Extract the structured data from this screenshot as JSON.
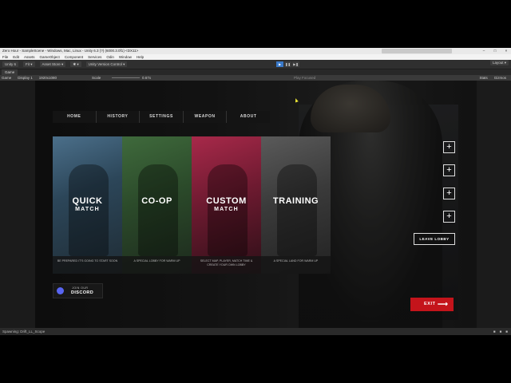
{
  "window": {
    "title": "Zero Hour - SampleScene - Windows, Mac, Linux - Unity 6.3 (?) (6000.3.0f1) <DX11>",
    "controls": [
      "–",
      "□",
      "×"
    ]
  },
  "menu": [
    "File",
    "Edit",
    "Assets",
    "GameObject",
    "Component",
    "Services",
    "Odin",
    "Window",
    "Help"
  ],
  "toolbar": {
    "unity_label": "Unity 6",
    "left_items": [
      "Fit ▾",
      "Asset Store ▾",
      "✱ ▾",
      "Unity Version Control ▾"
    ],
    "play_buttons": [
      "▶",
      "❚❚",
      "▶❚"
    ],
    "right_items": [
      "Layout ▾"
    ]
  },
  "tab": {
    "label": "Game"
  },
  "gamebar": {
    "items": [
      "Game",
      "Display 1",
      "1920x1080"
    ],
    "scale_label": "Scale",
    "scale_value": "0.67x",
    "play_focus": "Play Focused",
    "right_items": [
      "Stats",
      "Gizmos"
    ]
  },
  "nav": [
    "HOME",
    "HISTORY",
    "SETTINGS",
    "WEAPON",
    "ABOUT"
  ],
  "modes": [
    {
      "line1": "QUICK",
      "line2": "MATCH",
      "desc": "BE PREPARED IT'S GOING TO START SOON"
    },
    {
      "line1": "CO-OP",
      "line2": "",
      "desc": "A SPECIAL LOBBY FOR WARM UP"
    },
    {
      "line1": "CUSTOM",
      "line2": "MATCH",
      "desc": "SELECT MAP, PLAYER, MATCH TIME & CREATE YOUR OWN LOBBY"
    },
    {
      "line1": "TRAINING",
      "line2": "",
      "desc": "A SPECIAL LAND FOR WARM UP"
    }
  ],
  "party": {
    "slot_symbol": "+",
    "leave_label": "LEAVE LOBBY"
  },
  "discord": {
    "line1": "JOIN OUR",
    "line2": "DISCORD"
  },
  "exit": {
    "label": "EXIT",
    "arrow": "⟶"
  },
  "status": {
    "message": "Spawning: Drift_LL_Scope"
  },
  "colors": {
    "exit_red": "#c4141b",
    "discord_blue": "#5865f2",
    "play_active": "#3a79c8"
  }
}
